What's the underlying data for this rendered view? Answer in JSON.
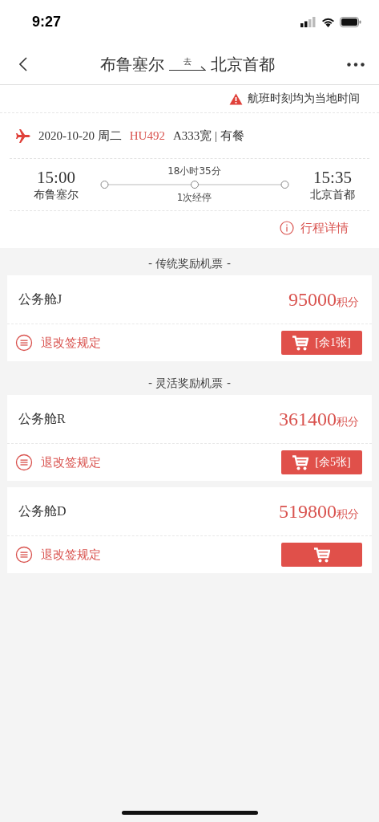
{
  "status_bar": {
    "time": "9:27"
  },
  "nav": {
    "origin": "布鲁塞尔",
    "direction": "去",
    "destination": "北京首都"
  },
  "notice": "航班时刻均为当地时间",
  "flight": {
    "date": "2020-10-20 周二",
    "flight_no": "HU492",
    "aircraft": "A333宽 | 有餐",
    "depart_time": "15:00",
    "depart_city": "布鲁塞尔",
    "duration": "18小时35分",
    "stops": "1次经停",
    "arrive_time": "15:35",
    "arrive_city": "北京首都",
    "details_link": "行程详情"
  },
  "sections": [
    {
      "title": "- 传统奖励机票 -",
      "fares": [
        {
          "cabin": "公务舱J",
          "points": "95000",
          "unit": "积分",
          "rules": "退改签规定",
          "remaining": "[余1张]"
        }
      ]
    },
    {
      "title": "- 灵活奖励机票 -",
      "fares": [
        {
          "cabin": "公务舱R",
          "points": "361400",
          "unit": "积分",
          "rules": "退改签规定",
          "remaining": "[余5张]"
        },
        {
          "cabin": "公务舱D",
          "points": "519800",
          "unit": "积分",
          "rules": "退改签规定"
        }
      ]
    }
  ]
}
